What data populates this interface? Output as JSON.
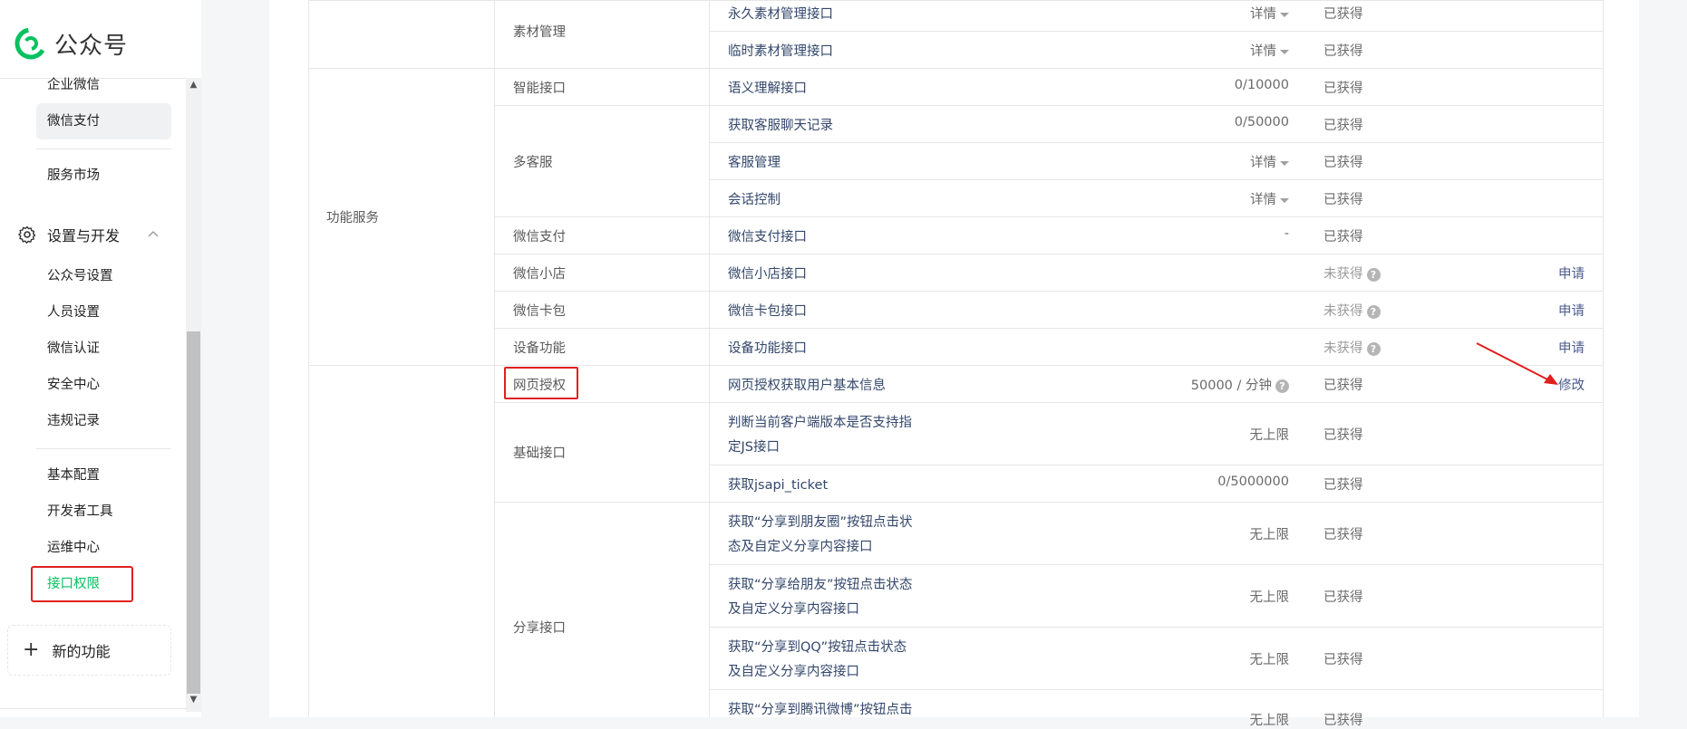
{
  "brand": {
    "name": "公众号",
    "accent": "#07c160"
  },
  "sidebar": {
    "items_top": [
      {
        "label": "企业微信"
      },
      {
        "label": "微信支付"
      },
      {
        "label": "服务市场"
      }
    ],
    "section": {
      "label": "设置与开发",
      "icon": "gear-icon"
    },
    "settings_items": [
      {
        "label": "公众号设置"
      },
      {
        "label": "人员设置"
      },
      {
        "label": "微信认证"
      },
      {
        "label": "安全中心"
      },
      {
        "label": "违规记录"
      }
    ],
    "dev_items": [
      {
        "label": "基本配置"
      },
      {
        "label": "开发者工具"
      },
      {
        "label": "运维中心"
      },
      {
        "label": "接口权限"
      }
    ],
    "new_feature": "新的功能"
  },
  "table": {
    "groups": {
      "func_service": "功能服务"
    },
    "subs": {
      "material": "素材管理",
      "smart": "智能接口",
      "kefu": "多客服",
      "wxpay": "微信支付",
      "shop": "微信小店",
      "card": "微信卡包",
      "device": "设备功能",
      "webauth": "网页授权",
      "basic": "基础接口",
      "share": "分享接口"
    },
    "rows": [
      {
        "name": "永久素材管理接口",
        "limit": "详情",
        "status": "已获得",
        "op": ""
      },
      {
        "name": "临时素材管理接口",
        "limit": "详情",
        "status": "已获得",
        "op": ""
      },
      {
        "name": "语义理解接口",
        "limit": "0/10000",
        "status": "已获得",
        "op": ""
      },
      {
        "name": "获取客服聊天记录",
        "limit": "0/50000",
        "status": "已获得",
        "op": ""
      },
      {
        "name": "客服管理",
        "limit": "详情",
        "status": "已获得",
        "op": ""
      },
      {
        "name": "会话控制",
        "limit": "详情",
        "status": "已获得",
        "op": ""
      },
      {
        "name": "微信支付接口",
        "limit": "-",
        "status": "已获得",
        "op": ""
      },
      {
        "name": "微信小店接口",
        "limit": "",
        "status": "未获得",
        "op": "申请"
      },
      {
        "name": "微信卡包接口",
        "limit": "",
        "status": "未获得",
        "op": "申请"
      },
      {
        "name": "设备功能接口",
        "limit": "",
        "status": "未获得",
        "op": "申请"
      },
      {
        "name": "网页授权获取用户基本信息",
        "limit": "50000 / 分钟",
        "status": "已获得",
        "op": "修改"
      },
      {
        "name_line1": "判断当前客户端版本是否支持指",
        "name_line2": "定JS接口",
        "limit": "无上限",
        "status": "已获得",
        "op": ""
      },
      {
        "name": "获取jsapi_ticket",
        "limit": "0/5000000",
        "status": "已获得",
        "op": ""
      },
      {
        "name_line1": "获取“分享到朋友圈”按钮点击状",
        "name_line2": "态及自定义分享内容接口",
        "limit": "无上限",
        "status": "已获得",
        "op": ""
      },
      {
        "name_line1": "获取“分享给朋友”按钮点击状态",
        "name_line2": "及自定义分享内容接口",
        "limit": "无上限",
        "status": "已获得",
        "op": ""
      },
      {
        "name_line1": "获取“分享到QQ”按钮点击状态",
        "name_line2": "及自定义分享内容接口",
        "limit": "无上限",
        "status": "已获得",
        "op": ""
      },
      {
        "name_line1": "获取“分享到腾讯微博”按钮点击",
        "limit": "无上限",
        "status": "已获得",
        "op": ""
      }
    ]
  }
}
